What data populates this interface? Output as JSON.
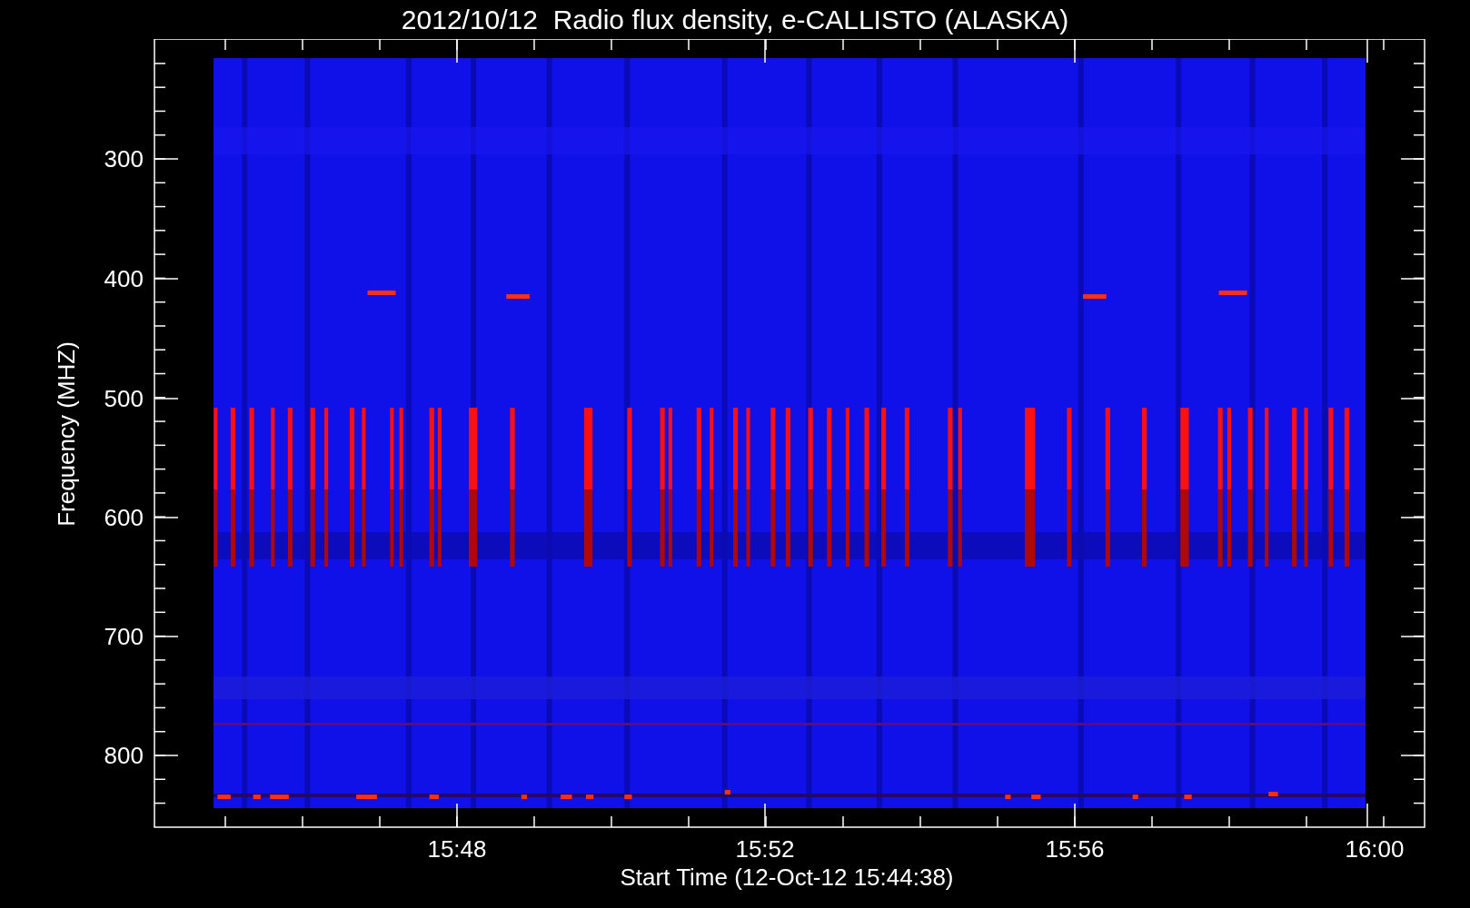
{
  "title": "2012/10/12  Radio flux density, e-CALLISTO (ALASKA)",
  "y_axis": {
    "label": "Frequency (MHZ)",
    "ticks": [
      "300",
      "400",
      "500",
      "600",
      "700",
      "800"
    ]
  },
  "x_axis": {
    "label": "Start Time (12-Oct-12 15:44:38)",
    "ticks": [
      "15:48",
      "15:52",
      "15:56",
      "16:00"
    ]
  }
}
